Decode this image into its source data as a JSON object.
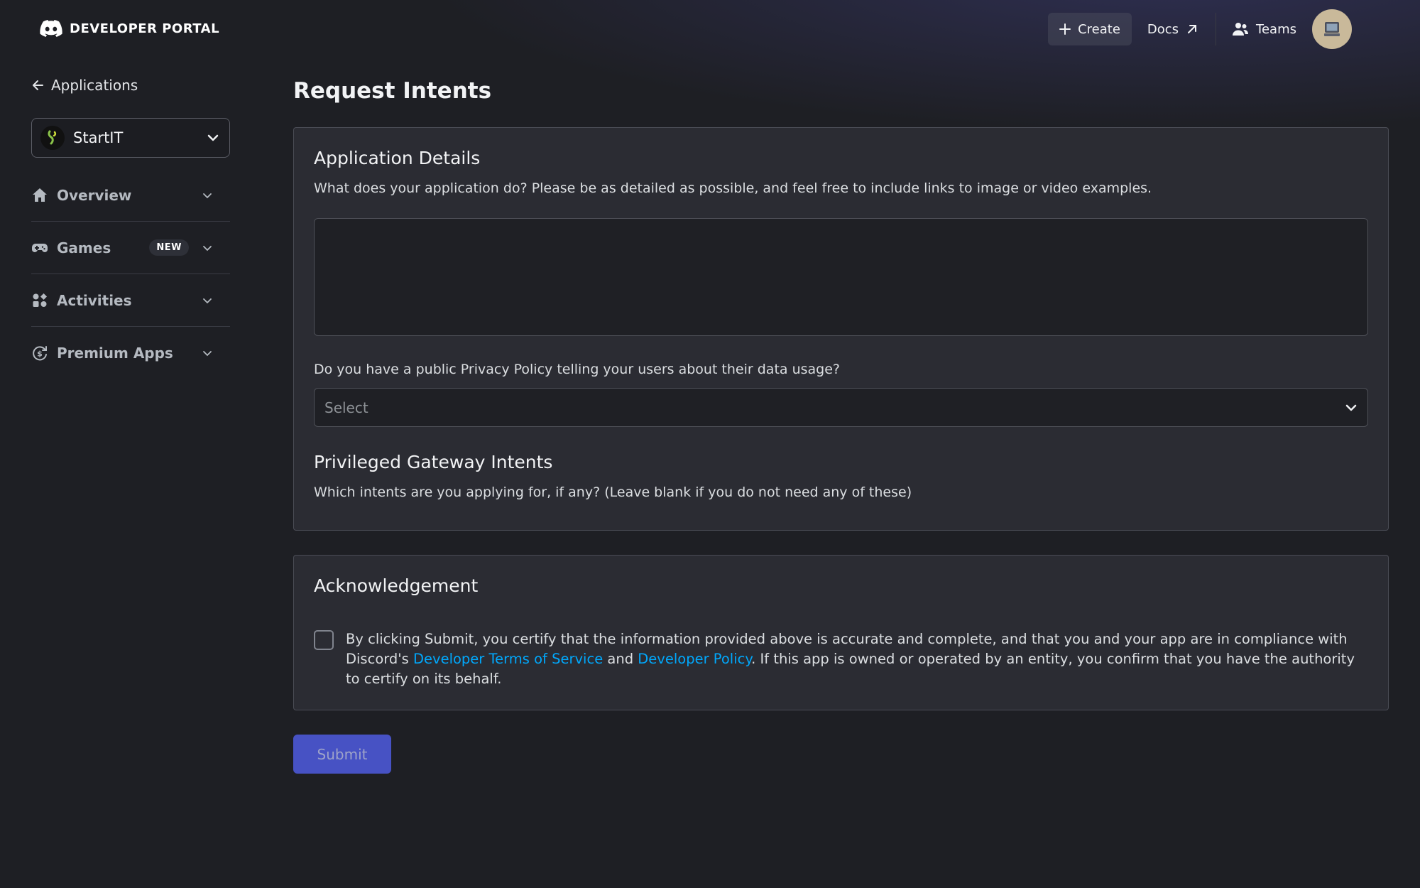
{
  "header": {
    "logo_text": "DEVELOPER PORTAL",
    "create_label": "Create",
    "docs_label": "Docs",
    "teams_label": "Teams"
  },
  "sidebar": {
    "back_label": "Applications",
    "app_name": "StartIT",
    "items": [
      {
        "label": "Overview",
        "icon": "home-icon"
      },
      {
        "label": "Games",
        "icon": "gamepad-icon",
        "badge": "NEW"
      },
      {
        "label": "Activities",
        "icon": "activities-icon"
      },
      {
        "label": "Premium Apps",
        "icon": "premium-apps-icon"
      }
    ]
  },
  "main": {
    "page_title": "Request Intents",
    "details": {
      "title": "Application Details",
      "description": "What does your application do? Please be as detailed as possible, and feel free to include links to image or video examples.",
      "textarea_value": "",
      "privacy_question": "Do you have a public Privacy Policy telling your users about their data usage?",
      "privacy_select_placeholder": "Select"
    },
    "intents": {
      "title": "Privileged Gateway Intents",
      "description": "Which intents are you applying for, if any? (Leave blank if you do not need any of these)"
    },
    "acknowledgement": {
      "title": "Acknowledgement",
      "text_part1": "By clicking Submit, you certify that the information provided above is accurate and complete, and that you and your app are in compliance with Discord's ",
      "tos_link": "Developer Terms of Service",
      "text_and": " and ",
      "policy_link": "Developer Policy",
      "text_part2": ". If this app is owned or operated by an entity, you confirm that you have the authority to certify on its behalf.",
      "checked": false
    },
    "submit_label": "Submit"
  },
  "colors": {
    "background": "#1e1f24",
    "card": "#2b2c33",
    "link": "#00a8fc",
    "submit": "#4752c4"
  }
}
